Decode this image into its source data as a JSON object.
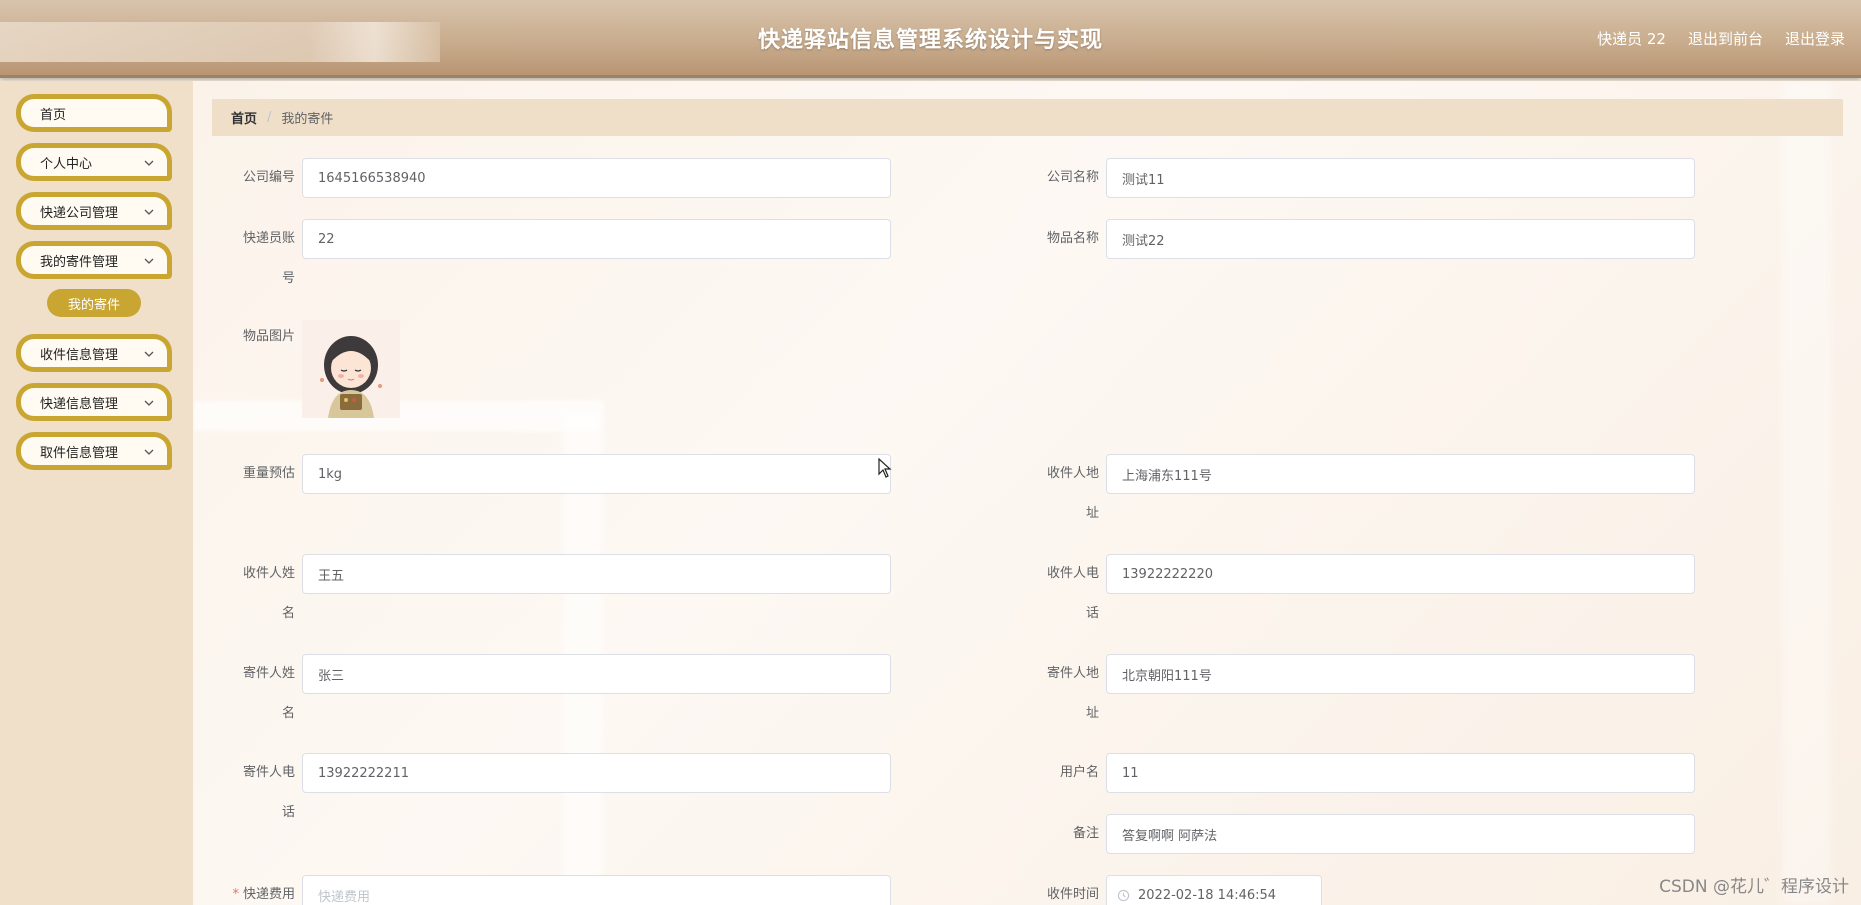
{
  "header": {
    "title": "快递驿站信息管理系统设计与实现",
    "user_label": "快递员 22",
    "front_link": "退出到前台",
    "logout_link": "退出登录"
  },
  "sidebar": {
    "items": [
      {
        "label": "首页"
      },
      {
        "label": "个人中心"
      },
      {
        "label": "快递公司管理"
      },
      {
        "label": "我的寄件管理"
      },
      {
        "label": "收件信息管理"
      },
      {
        "label": "快递信息管理"
      },
      {
        "label": "取件信息管理"
      }
    ],
    "active_sub": "我的寄件"
  },
  "breadcrumb": {
    "home": "首页",
    "separator": "/",
    "current": "我的寄件"
  },
  "form": {
    "company_no": {
      "label": "公司编号",
      "value": "1645166538940"
    },
    "company_name": {
      "label": "公司名称",
      "value": "测试11"
    },
    "courier_account": {
      "label": "快递员账号",
      "value": "22"
    },
    "item_name": {
      "label": "物品名称",
      "value": "测试22"
    },
    "item_image": {
      "label": "物品图片"
    },
    "weight": {
      "label": "重量预估",
      "value": "1kg"
    },
    "receiver_address": {
      "label": "收件人地址",
      "value": "上海浦东111号"
    },
    "receiver_name": {
      "label": "收件人姓名",
      "value": "王五"
    },
    "receiver_phone": {
      "label": "收件人电话",
      "value": "13922222220"
    },
    "sender_name": {
      "label": "寄件人姓名",
      "value": "张三"
    },
    "sender_address": {
      "label": "寄件人地址",
      "value": "北京朝阳111号"
    },
    "sender_phone": {
      "label": "寄件人电话",
      "value": "13922222211"
    },
    "username": {
      "label": "用户名",
      "value": "11"
    },
    "remark": {
      "label": "备注",
      "value": "答复啊啊 阿萨法"
    },
    "fee": {
      "label": "快递费用",
      "required_mark": "*",
      "placeholder": "快递费用"
    },
    "receive_time": {
      "label": "收件时间",
      "value": "2022-02-18 14:46:54"
    }
  },
  "watermark": "CSDN @花儿゛程序设计",
  "colors": {
    "accent_gold": "#c9a531",
    "sidebar_bg": "#f0e0c9",
    "breadcrumb_bg": "#f0dfc8"
  }
}
